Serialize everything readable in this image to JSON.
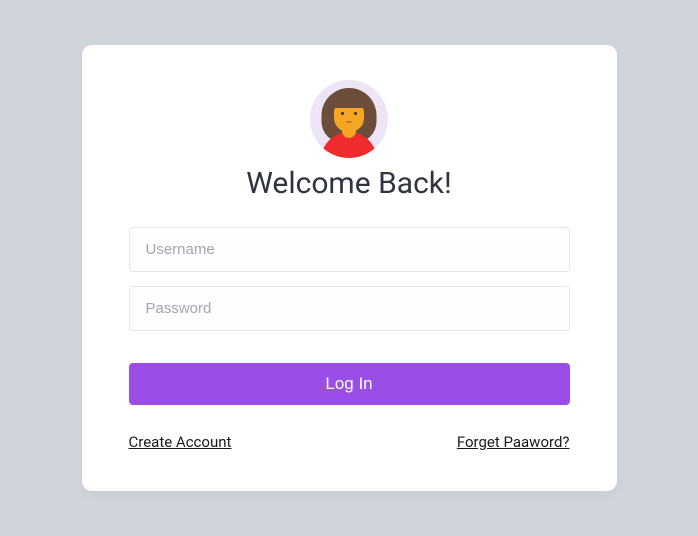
{
  "title": "Welcome Back!",
  "username": {
    "placeholder": "Username",
    "value": ""
  },
  "password": {
    "placeholder": "Password",
    "value": ""
  },
  "login_button": "Log In",
  "create_account": "Create Account",
  "forget_password": "Forget Paaword?",
  "colors": {
    "accent": "#9b4de8",
    "background": "#d0d5db",
    "card": "#ffffff"
  }
}
